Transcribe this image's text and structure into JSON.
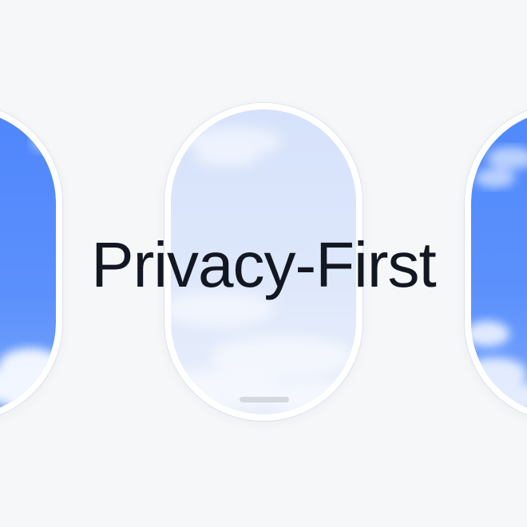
{
  "headline": "Privacy-First",
  "colors": {
    "background": "#f6f7f9",
    "frame": "#ffffff",
    "sky_deep": "#5b8dfc",
    "sky_pale": "#dbe6fb",
    "text": "#121722",
    "home_indicator": "#d4d8df"
  },
  "windows": [
    {
      "name": "left-window",
      "style": "deep-blue-sky-with-clouds"
    },
    {
      "name": "center-window",
      "style": "pale-blue-sky-with-clouds"
    },
    {
      "name": "right-window",
      "style": "deep-blue-sky-with-clouds"
    }
  ]
}
